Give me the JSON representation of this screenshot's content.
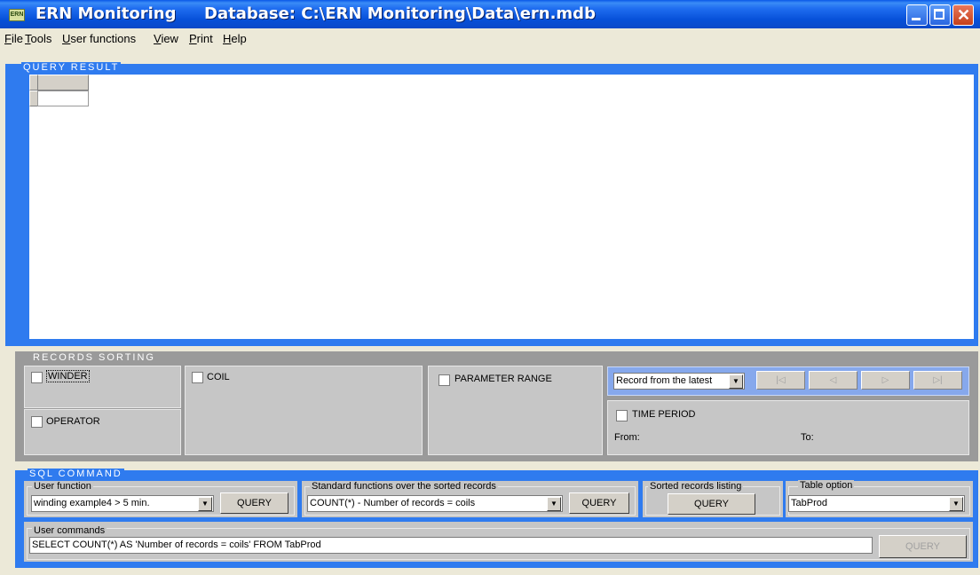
{
  "titlebar": {
    "app_name": "ERN Monitoring",
    "database_label": "Database: C:\\ERN Monitoring\\Data\\ern.mdb",
    "icon_text": "ERN"
  },
  "menu": {
    "items": [
      "File",
      "Tools",
      "User functions",
      "View",
      "Print",
      "Help"
    ]
  },
  "query_result": {
    "title": "QUERY RESULT"
  },
  "records_sorting": {
    "title": "RECORDS SORTING",
    "winder_label": "WINDER",
    "operator_label": "OPERATOR",
    "coil_label": "COIL",
    "parameter_range_label": "PARAMETER RANGE",
    "record_select_value": "Record from the latest",
    "time_period_label": "TIME PERIOD",
    "from_label": "From:",
    "to_label": "To:",
    "nav_icons": [
      "first-record-icon",
      "prev-record-icon",
      "next-record-icon",
      "last-record-icon"
    ]
  },
  "sql_command": {
    "title": "SQL COMMAND",
    "user_function": {
      "label": "User function",
      "value": "winding  example4  > 5 min.",
      "button": "QUERY"
    },
    "standard_functions": {
      "label": "Standard functions over the sorted records",
      "value": "COUNT(*) - Number of records = coils",
      "button": "QUERY"
    },
    "sorted_listing": {
      "label": "Sorted records listing",
      "button": "QUERY"
    },
    "table_option": {
      "label": "Table option",
      "value": "TabProd"
    },
    "user_commands": {
      "label": "User commands",
      "value": "SELECT COUNT(*)  AS 'Number of records = coils' FROM TabProd",
      "button": "QUERY"
    }
  },
  "colors": {
    "title_blue": "#0a58e8",
    "panel_blue": "#2f7bef",
    "panel_gray": "#9a9a9a",
    "close_red": "#c6401a"
  }
}
